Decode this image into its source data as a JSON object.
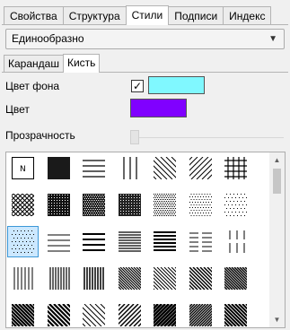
{
  "tabs": [
    {
      "label": "Свойства",
      "active": false
    },
    {
      "label": "Структура",
      "active": false
    },
    {
      "label": "Стили",
      "active": true
    },
    {
      "label": "Подписи",
      "active": false
    },
    {
      "label": "Индекс",
      "active": false
    }
  ],
  "style_dropdown": {
    "value": "Единообразно"
  },
  "subtabs": [
    {
      "label": "Карандаш",
      "active": false
    },
    {
      "label": "Кисть",
      "active": true
    }
  ],
  "fields": {
    "background_color_label": "Цвет фона",
    "background_color_checked": true,
    "background_color_value": "#80f8ff",
    "color_label": "Цвет",
    "color_value": "#8000ff",
    "transparency_label": "Прозрачность",
    "transparency_value": 0
  },
  "patterns": {
    "selected_index": 14,
    "items": [
      "N",
      "solid",
      "horiz",
      "vert",
      "diag-down",
      "diag-up",
      "cross",
      "diag-cross",
      "dense-1",
      "dense-2",
      "dense-3",
      "dense-4",
      "dense-5",
      "dense-6",
      "dots-sparse",
      "horiz-thin",
      "horiz-med",
      "horiz-dense",
      "horiz-dense2",
      "horiz-dash",
      "vert-dash",
      "vert-thin",
      "vert-med",
      "vert-dense",
      "vert-wave",
      "diag-thin",
      "diag-med",
      "diag-dense",
      "diag-thick",
      "diag-thick2",
      "diag-thin2",
      "diag-med2",
      "diag-thick3",
      "diag-dense2",
      "diag-dense3"
    ]
  },
  "icons": {
    "dropdown_arrow": "chevron-down-icon",
    "scroll_up": "arrow-up-icon",
    "scroll_down": "arrow-down-icon"
  }
}
